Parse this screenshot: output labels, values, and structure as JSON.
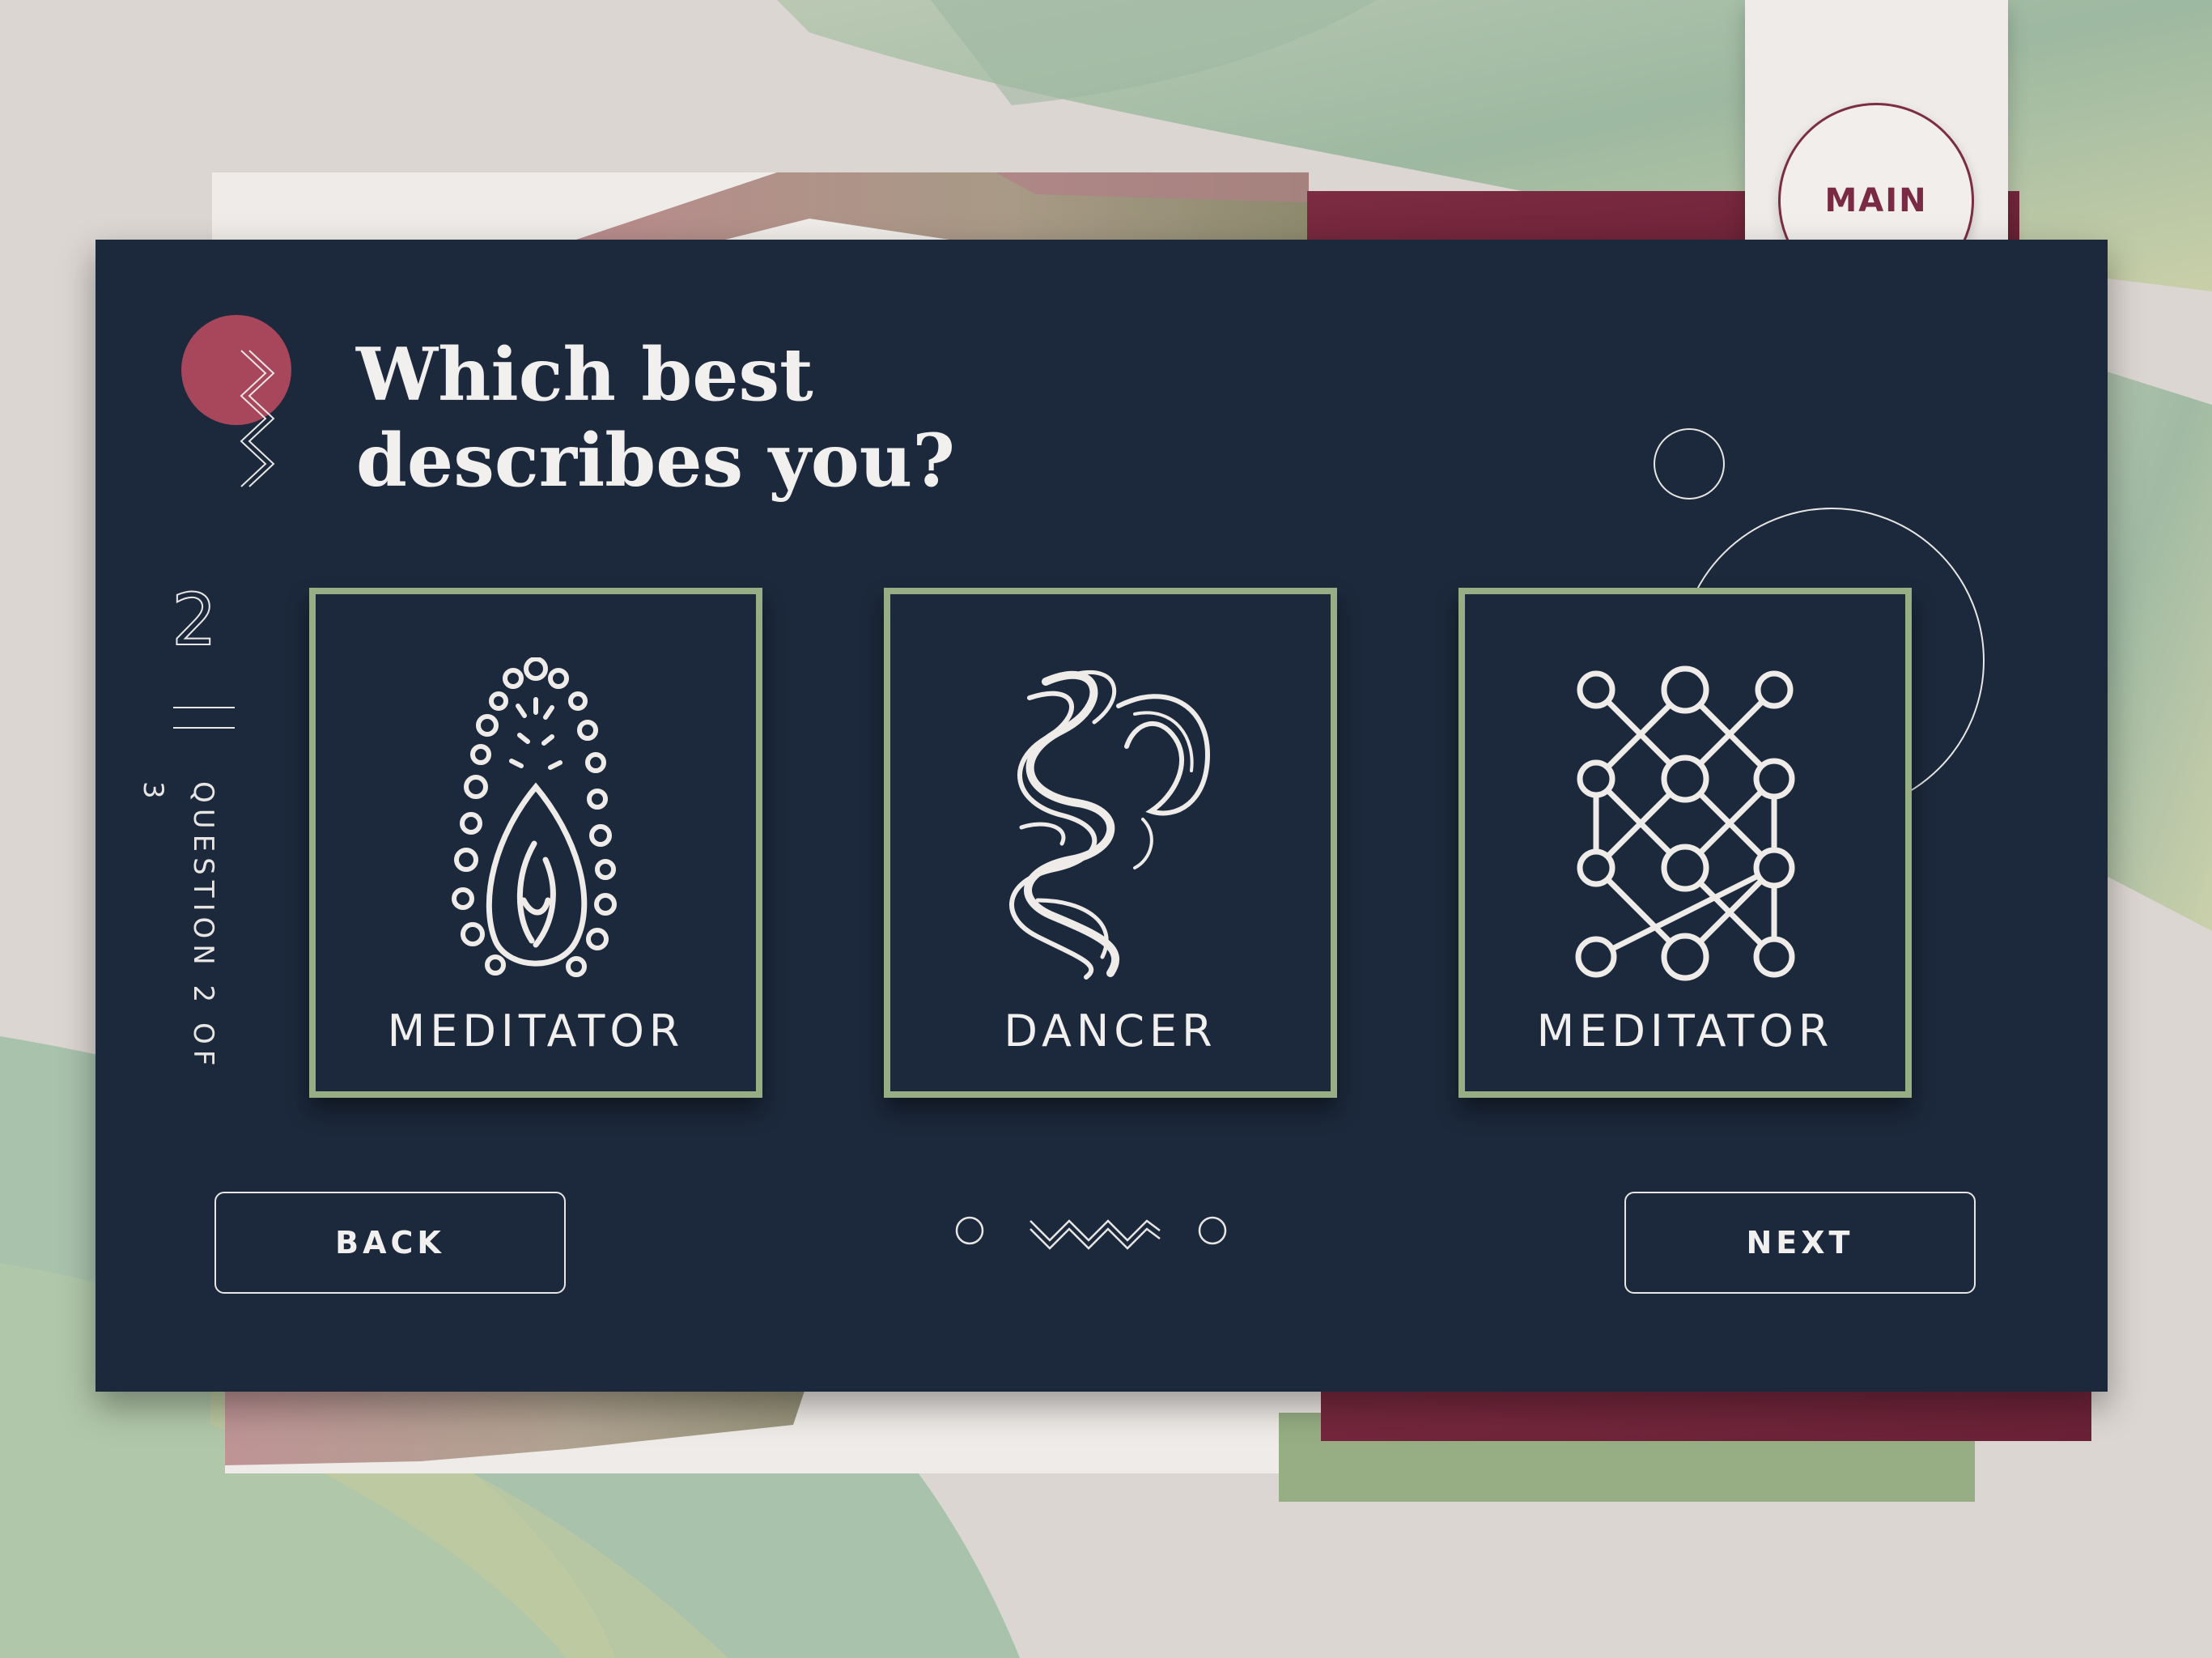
{
  "header": {
    "title_line1": "Which best",
    "title_line2": "describes you?"
  },
  "main_button": {
    "label": "MAIN"
  },
  "progress": {
    "number": "2",
    "label": "QUESTION 2 OF 3",
    "current": 2,
    "total": 3
  },
  "options": [
    {
      "label": "MEDITATOR",
      "icon": "flame-seed-icon"
    },
    {
      "label": "DANCER",
      "icon": "swirl-icon"
    },
    {
      "label": "MEDITATOR",
      "icon": "network-grid-icon"
    }
  ],
  "nav": {
    "back_label": "BACK",
    "next_label": "NEXT"
  },
  "colors": {
    "card_bg": "#1c293c",
    "card_border": "#97ae84",
    "accent_maroon": "#7b2d45",
    "accent_pink": "#a8465c",
    "text_light": "#f2f0ee",
    "green_paper": "#97ae84"
  }
}
